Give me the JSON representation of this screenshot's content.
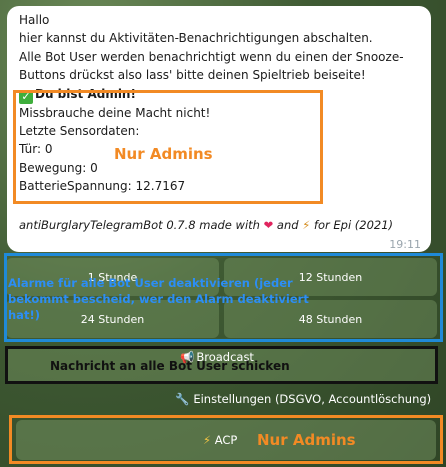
{
  "message": {
    "greeting": "Hallo",
    "line1": "hier kannst du Aktivitäten-Benachrichtigungen abschalten.",
    "line2": "Alle Bot User werden benachrichtigt wenn du einen der Snooze-",
    "line3": "Buttons drückst also lass' bitte deinen Spieltrieb beiseite!",
    "admin_label": "Du bist Admin!",
    "admin_warning": "Missbrauche deine Macht nicht!",
    "sensor_heading": "Letzte Sensordaten:",
    "door": "Tür: 0",
    "motion": "Bewegung: 0",
    "battery": "BatterieSpannung: 12.7167",
    "footer_pre": "antiBurglaryTelegramBot 0.7.8 made with",
    "footer_mid": "and",
    "footer_post": "for Epi (2021)",
    "time": "19:11"
  },
  "annotations": {
    "nur_admins": "Nur Admins",
    "blue_note": "Alarme für alle Bot User deaktivieren (jeder bekommt bescheid, wer den Alarm deaktiviert hat!)",
    "black_note": "Nachricht an alle Bot User schicken",
    "acp_nur_admins": "Nur Admins"
  },
  "keyboard": {
    "btn_1h": "1 Stunde",
    "btn_12h": "12 Stunden",
    "btn_24h": "24 Stunden",
    "btn_48h": "48 Stunden",
    "broadcast": "Broadcast",
    "settings": "Einstellungen (DSGVO, Accountlöschung)",
    "acp": "ACP"
  },
  "icons": {
    "check": "check-icon",
    "heart": "heart-icon",
    "megaphone": "megaphone-icon",
    "wrench": "wrench-icon",
    "bolt": "lightning-icon"
  },
  "colors": {
    "orange": "#f28a24",
    "blue": "#1f8ad8",
    "check_green": "#3fae3c"
  }
}
